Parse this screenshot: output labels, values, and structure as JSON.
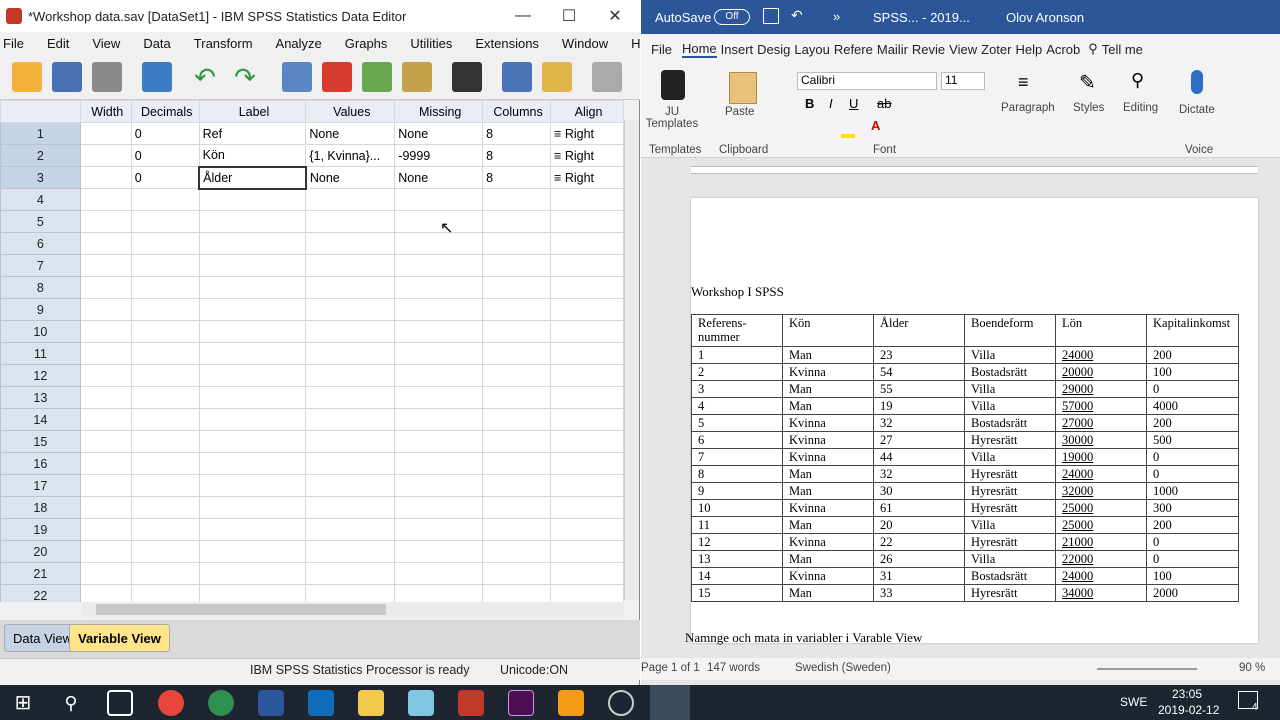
{
  "spss": {
    "title": "*Workshop data.sav [DataSet1] - IBM SPSS Statistics Data Editor",
    "menu": [
      "File",
      "Edit",
      "View",
      "Data",
      "Transform",
      "Analyze",
      "Graphs",
      "Utilities",
      "Extensions",
      "Window",
      "Help"
    ],
    "columns": [
      "Width",
      "Decimals",
      "Label",
      "Values",
      "Missing",
      "Columns",
      "Align"
    ],
    "rows": [
      {
        "n": "1",
        "width": "",
        "decimals": "0",
        "label": "Ref",
        "values": "None",
        "missing": "None",
        "columns": "8",
        "align": "Right"
      },
      {
        "n": "2",
        "width": "",
        "decimals": "0",
        "label": "Kön",
        "values": "{1, Kvinna}...",
        "missing": "-9999",
        "columns": "8",
        "align": "Right"
      },
      {
        "n": "3",
        "width": "",
        "decimals": "0",
        "label": "Ålder",
        "values": "None",
        "missing": "None",
        "columns": "8",
        "align": "Right"
      }
    ],
    "empty_rows": [
      "4",
      "5",
      "6",
      "7",
      "8",
      "9",
      "10",
      "11",
      "12",
      "13",
      "14",
      "15",
      "16",
      "17",
      "18",
      "19",
      "20",
      "21",
      "22"
    ],
    "tabs": {
      "data_view": "Data View",
      "variable_view": "Variable View"
    },
    "status": {
      "processor": "IBM SPSS Statistics Processor is ready",
      "unicode": "Unicode:ON"
    }
  },
  "word": {
    "autosave_label": "AutoSave",
    "autosave_state": "Off",
    "doc_title": "SPSS... - 2019...",
    "user": "Olov Aronson",
    "tabs": [
      "File",
      "Home",
      "Insert",
      "Desig",
      "Layou",
      "Refere",
      "Mailir",
      "Revie",
      "View",
      "Zoter",
      "Help",
      "Acrob"
    ],
    "tell_me": "Tell me",
    "ribbon": {
      "ju_templates": "JU Templates",
      "templates_group": "Templates",
      "paste": "Paste",
      "clipboard_group": "Clipboard",
      "font_name": "Calibri",
      "font_size": "11",
      "font_group": "Font",
      "paragraph": "Paragraph",
      "styles": "Styles",
      "editing": "Editing",
      "dictate": "Dictate",
      "voice_group": "Voice"
    },
    "heading": "Workshop I SPSS",
    "table_headers": [
      "Referens-nummer",
      "Kön",
      "Ålder",
      "Boendeform",
      "Lön",
      "Kapitalinkomst"
    ],
    "table_rows": [
      [
        "1",
        "Man",
        "23",
        "Villa",
        "24000",
        "200"
      ],
      [
        "2",
        "Kvinna",
        "54",
        "Bostadsrätt",
        "20000",
        "100"
      ],
      [
        "3",
        "Man",
        "55",
        "Villa",
        "29000",
        "0"
      ],
      [
        "4",
        "Man",
        "19",
        "Villa",
        "57000",
        "4000"
      ],
      [
        "5",
        "Kvinna",
        "32",
        "Bostadsrätt",
        "27000",
        "200"
      ],
      [
        "6",
        "Kvinna",
        "27",
        "Hyresrätt",
        "30000",
        "500"
      ],
      [
        "7",
        "Kvinna",
        "44",
        "Villa",
        "19000",
        "0"
      ],
      [
        "8",
        "Man",
        "32",
        "Hyresrätt",
        "24000",
        "0"
      ],
      [
        "9",
        "Man",
        "30",
        "Hyresrätt",
        "32000",
        "1000"
      ],
      [
        "10",
        "Kvinna",
        "61",
        "Hyresrätt",
        "25000",
        "300"
      ],
      [
        "11",
        "Man",
        "20",
        "Villa",
        "25000",
        "200"
      ],
      [
        "12",
        "Kvinna",
        "22",
        "Hyresrätt",
        "21000",
        "0"
      ],
      [
        "13",
        "Man",
        "26",
        "Villa",
        "22000",
        "0"
      ],
      [
        "14",
        "Kvinna",
        "31",
        "Bostadsrätt",
        "24000",
        "100"
      ],
      [
        "15",
        "Man",
        "33",
        "Hyresrätt",
        "34000",
        "2000"
      ]
    ],
    "next_line": "Namnge och mata in variabler i Varable View",
    "status": {
      "page": "Page 1 of 1",
      "words": "147 words",
      "language": "Swedish (Sweden)",
      "zoom": "90 %"
    }
  },
  "taskbar": {
    "lang": "SWE",
    "time": "23:05",
    "date": "2019-02-12",
    "notifications": "4"
  },
  "colors": {
    "word_blue": "#2b579a",
    "spss_active_tab": "#ffe48a",
    "taskbar": "#1c2530"
  }
}
